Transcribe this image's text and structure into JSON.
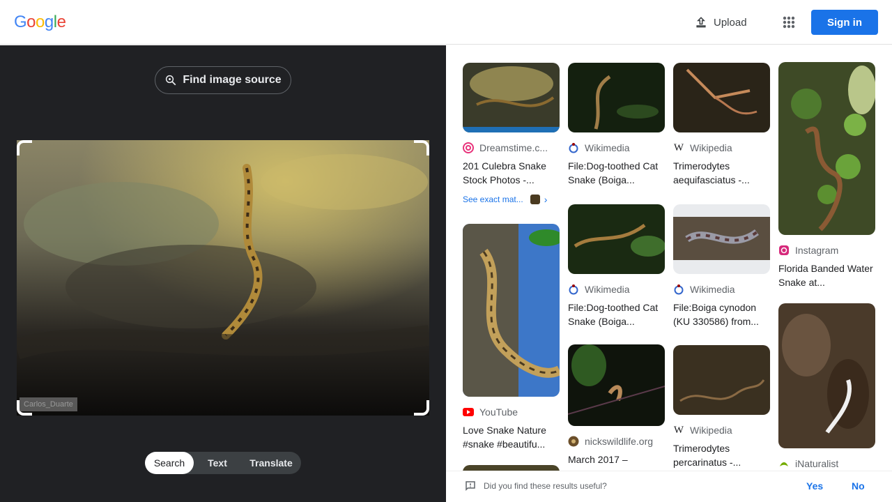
{
  "header": {
    "logo": [
      "G",
      "o",
      "o",
      "g",
      "l",
      "e"
    ],
    "logo_colors": [
      "#4285f4",
      "#ea4335",
      "#fbbc05",
      "#4285f4",
      "#34a853",
      "#ea4335"
    ],
    "upload_label": "Upload",
    "signin_label": "Sign in"
  },
  "left": {
    "find_source_label": "Find image source",
    "watermark": "Carlos_Duarte",
    "tabs": [
      {
        "label": "Search",
        "active": true
      },
      {
        "label": "Text",
        "active": false
      },
      {
        "label": "Translate",
        "active": false
      }
    ]
  },
  "results": [
    {
      "source": "Dreamstime.c...",
      "title": "201 Culebra Snake Stock Photos -...",
      "icon": "dreamstime-icon",
      "exact": "See exact mat..."
    },
    {
      "source": "Wikimedia",
      "title": "File:Dog-toothed Cat Snake (Boiga...",
      "icon": "wikimedia-icon"
    },
    {
      "source": "Wikipedia",
      "title": "Trimerodytes aequifasciatus -...",
      "icon": "wikipedia-icon"
    },
    {
      "source": "Instagram",
      "title": "Florida Banded Water Snake at...",
      "icon": "instagram-icon"
    },
    {
      "source": "YouTube",
      "title": "Love Snake Nature #snake #beautifu...",
      "icon": "youtube-icon"
    },
    {
      "source": "Wikimedia",
      "title": "File:Dog-toothed Cat Snake (Boiga...",
      "icon": "wikimedia-icon"
    },
    {
      "source": "Wikimedia",
      "title": "File:Boiga cynodon (KU 330586) from...",
      "icon": "wikimedia-icon"
    },
    {
      "source": "nickswildlife.org",
      "title": "March 2017 –",
      "icon": "nickswildlife-icon"
    },
    {
      "source": "Wikipedia",
      "title": "Trimerodytes percarinatus -...",
      "icon": "wikipedia-icon"
    },
    {
      "source": "iNaturalist",
      "title": "",
      "icon": "inaturalist-icon"
    }
  ],
  "feedback": {
    "question": "Did you find these results useful?",
    "yes": "Yes",
    "no": "No"
  }
}
